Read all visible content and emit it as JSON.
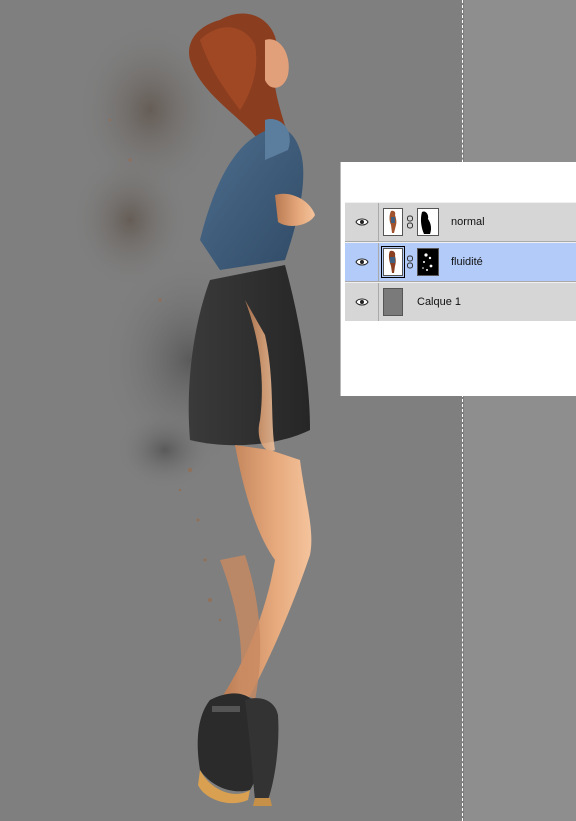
{
  "layers_panel": {
    "layers": [
      {
        "name": "normal",
        "selected": false,
        "visible": true,
        "has_mask": true,
        "mask_style": "white-with-black-shape"
      },
      {
        "name": "fluidité",
        "selected": true,
        "visible": true,
        "has_mask": true,
        "mask_style": "black-with-white-specks"
      },
      {
        "name": "Calque 1",
        "selected": false,
        "visible": true,
        "has_mask": false,
        "thumbnail_color": "#7a7a7a"
      }
    ],
    "icons": {
      "visibility": "eye-icon",
      "link": "chain-link-icon"
    },
    "colors": {
      "row_bg": "#d6d6d6",
      "selected_bg": "#b3cbf8"
    }
  },
  "canvas": {
    "background_color": "#7f7f7f",
    "outside_color": "#8e8e8e",
    "content": "woman-figure-disintegration-effect"
  }
}
